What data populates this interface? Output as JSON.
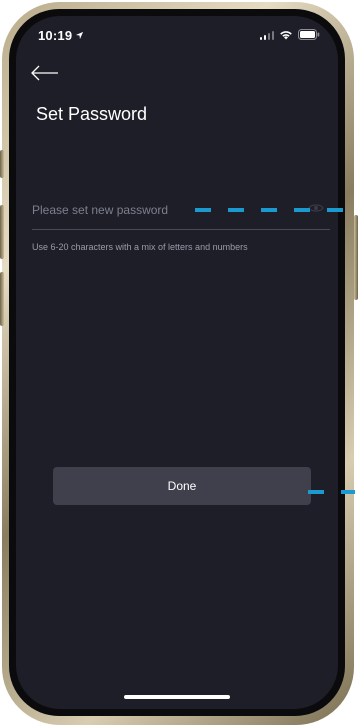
{
  "status_bar": {
    "time": "10:19",
    "location_icon": "navigation-arrow-icon",
    "signal_icon": "cellular-signal-icon",
    "wifi_icon": "wifi-icon",
    "battery_icon": "battery-icon"
  },
  "header": {
    "back_icon": "back-arrow-icon",
    "title": "Set Password"
  },
  "password_field": {
    "placeholder": "Please set new password",
    "value": "",
    "visibility_icon": "eye-icon"
  },
  "hint": "Use 6-20 characters with a mix of letters and numbers",
  "done_button": {
    "label": "Done"
  },
  "colors": {
    "background": "#1d1e28",
    "button": "#3f404c",
    "annotation": "#1c9ad0"
  }
}
